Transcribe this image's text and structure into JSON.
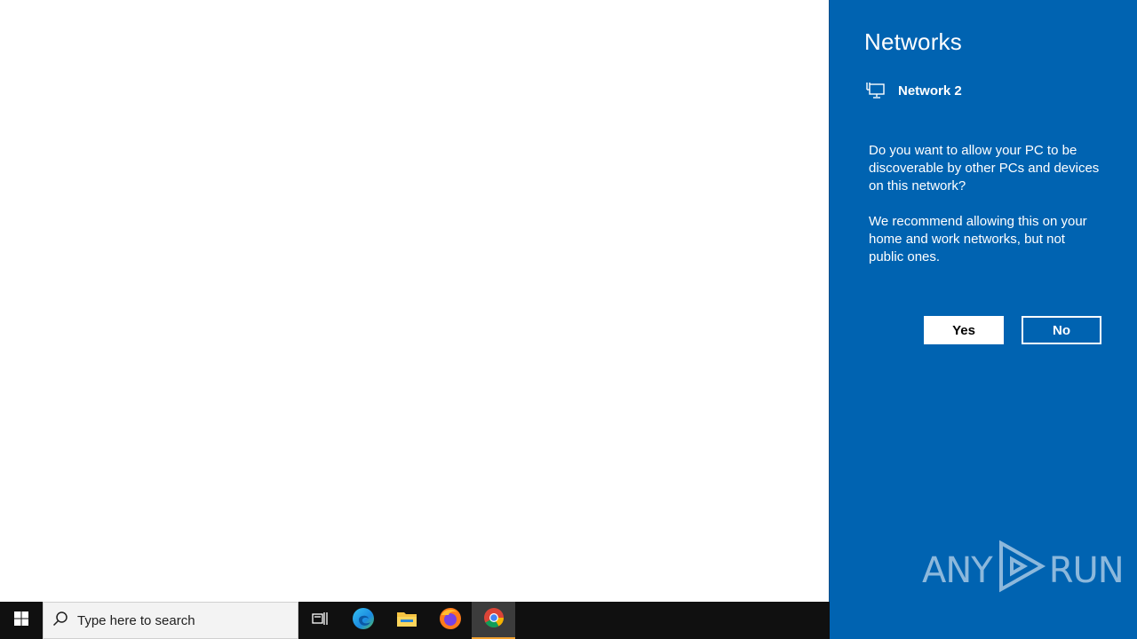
{
  "flyout": {
    "title": "Networks",
    "network_name": "Network 2",
    "network_icon": "ethernet-icon",
    "message_line1": "Do you want to allow your PC to be discoverable by other PCs and devices on this network?",
    "message_line2": "We recommend allowing this on your home and work networks, but not public ones.",
    "yes_label": "Yes",
    "no_label": "No",
    "background_color": "#0063b1"
  },
  "watermark": {
    "text_left": "ANY",
    "text_right": "RUN"
  },
  "taskbar": {
    "search_placeholder": "Type here to search",
    "pinned": [
      {
        "name": "Microsoft Edge",
        "icon": "edge-icon"
      },
      {
        "name": "File Explorer",
        "icon": "folder-icon"
      },
      {
        "name": "Firefox",
        "icon": "firefox-icon"
      },
      {
        "name": "Google Chrome",
        "icon": "chrome-icon",
        "active": true
      }
    ]
  }
}
